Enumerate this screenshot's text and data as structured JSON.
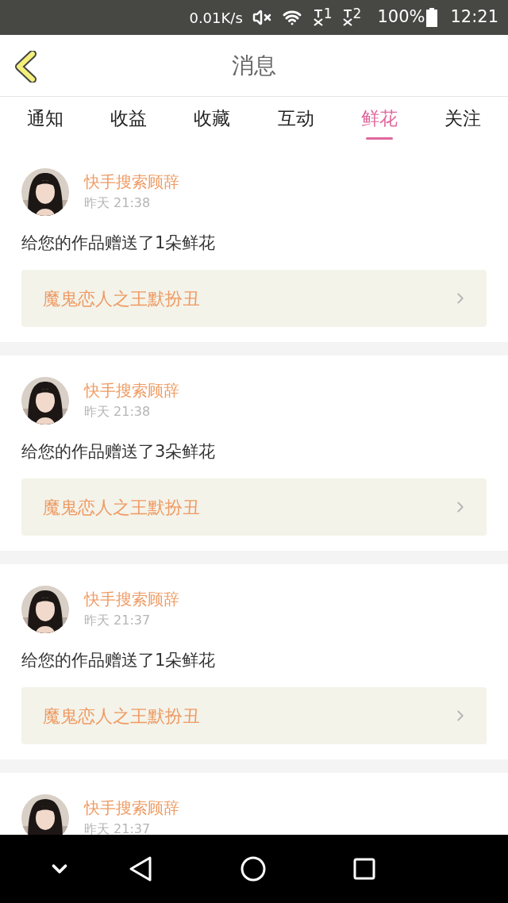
{
  "status_bar": {
    "speed": "0.01K/s",
    "sims": [
      "1",
      "2"
    ],
    "battery": "100%",
    "time": "12:21"
  },
  "header": {
    "title": "消息"
  },
  "tabs": [
    {
      "label": "通知",
      "selected": false
    },
    {
      "label": "收益",
      "selected": false
    },
    {
      "label": "收藏",
      "selected": false
    },
    {
      "label": "互动",
      "selected": false
    },
    {
      "label": "鲜花",
      "selected": true
    },
    {
      "label": "关注",
      "selected": false
    }
  ],
  "messages": [
    {
      "user": "快手搜索顾辞",
      "time": "昨天 21:38",
      "text": "给您的作品赠送了1朵鲜花",
      "work": "魔鬼恋人之王默扮丑"
    },
    {
      "user": "快手搜索顾辞",
      "time": "昨天 21:38",
      "text": "给您的作品赠送了3朵鲜花",
      "work": "魔鬼恋人之王默扮丑"
    },
    {
      "user": "快手搜索顾辞",
      "time": "昨天 21:37",
      "text": "给您的作品赠送了1朵鲜花",
      "work": "魔鬼恋人之王默扮丑"
    },
    {
      "user": "快手搜索顾辞",
      "time": "昨天 21:37"
    }
  ]
}
